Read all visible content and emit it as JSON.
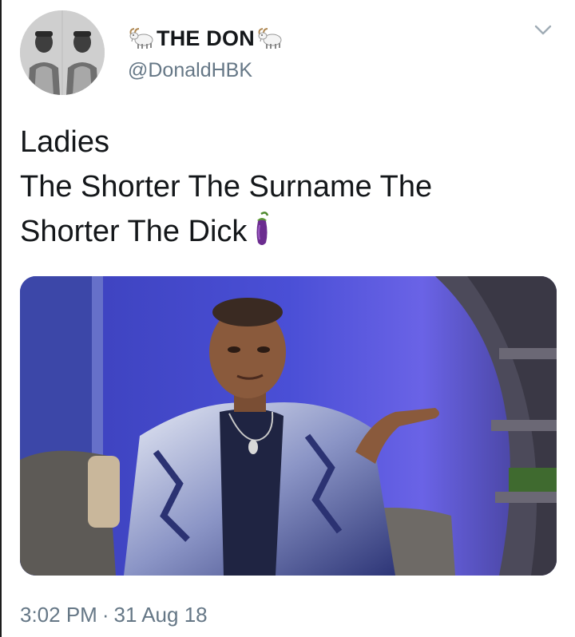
{
  "tweet": {
    "author": {
      "display_name": "THE DON",
      "handle": "@DonaldHBK",
      "name_emoji_left": "goat-icon",
      "name_emoji_right": "goat-icon"
    },
    "text_lines": [
      "Ladies",
      "The Shorter The Surname The",
      "Shorter The Dick"
    ],
    "text_emoji": "eggplant-icon",
    "media": {
      "type": "photo"
    },
    "time": "3:02 PM",
    "separator": "·",
    "date": "31 Aug 18"
  },
  "colors": {
    "text": "#14171a",
    "secondary": "#657786",
    "media_background": "#3b43b8"
  }
}
